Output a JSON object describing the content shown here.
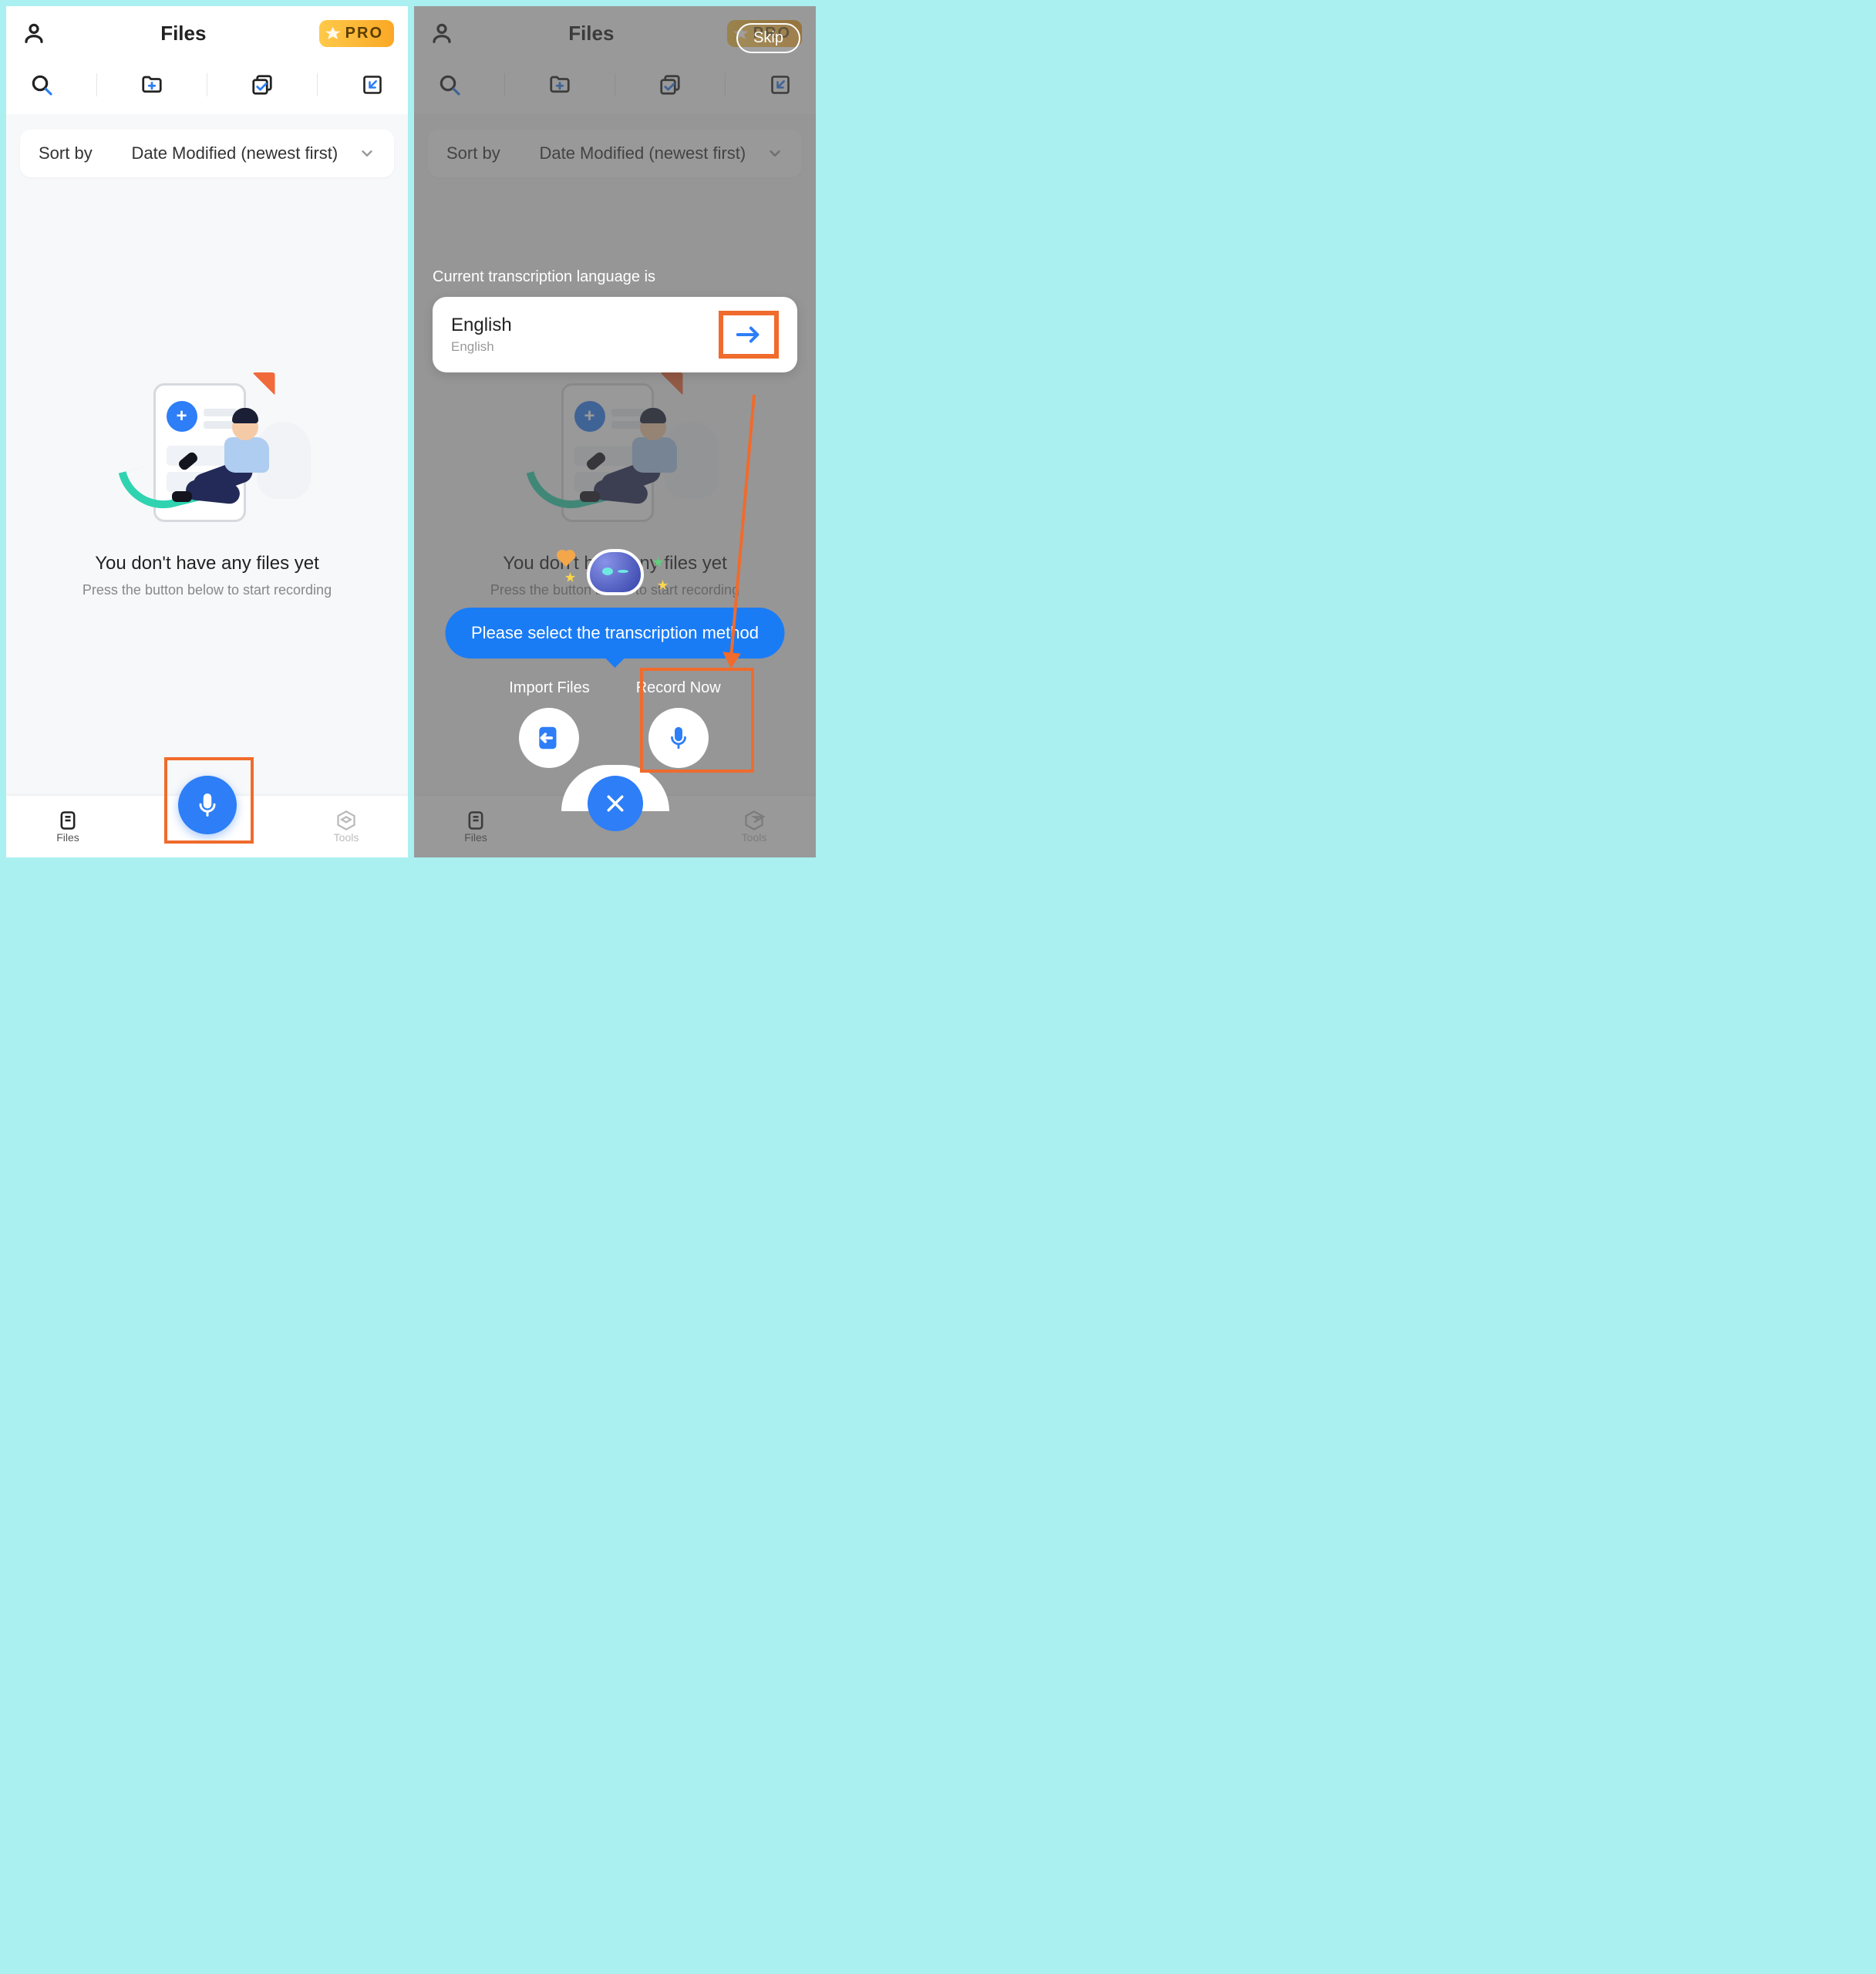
{
  "left": {
    "header_title": "Files",
    "pro_badge": "PRO",
    "sort_label": "Sort by",
    "sort_value": "Date Modified (newest first)",
    "empty_title": "You don't have any files yet",
    "empty_sub": "Press the button below to start recording",
    "nav_files": "Files",
    "nav_tools": "Tools"
  },
  "right": {
    "header_title": "Files",
    "pro_badge": "PRO",
    "skip_label": "Skip",
    "sort_label": "Sort by",
    "sort_value": "Date Modified (newest first)",
    "lang_heading": "Current transcription language is",
    "lang_main": "English",
    "lang_sub": "English",
    "empty_title": "You don't have any files yet",
    "empty_sub": "Press the button below to start recording",
    "tooltip": "Please select the transcription method",
    "method_import": "Import Files",
    "method_record": "Record Now",
    "nav_files": "Files",
    "nav_tools": "Tools"
  }
}
